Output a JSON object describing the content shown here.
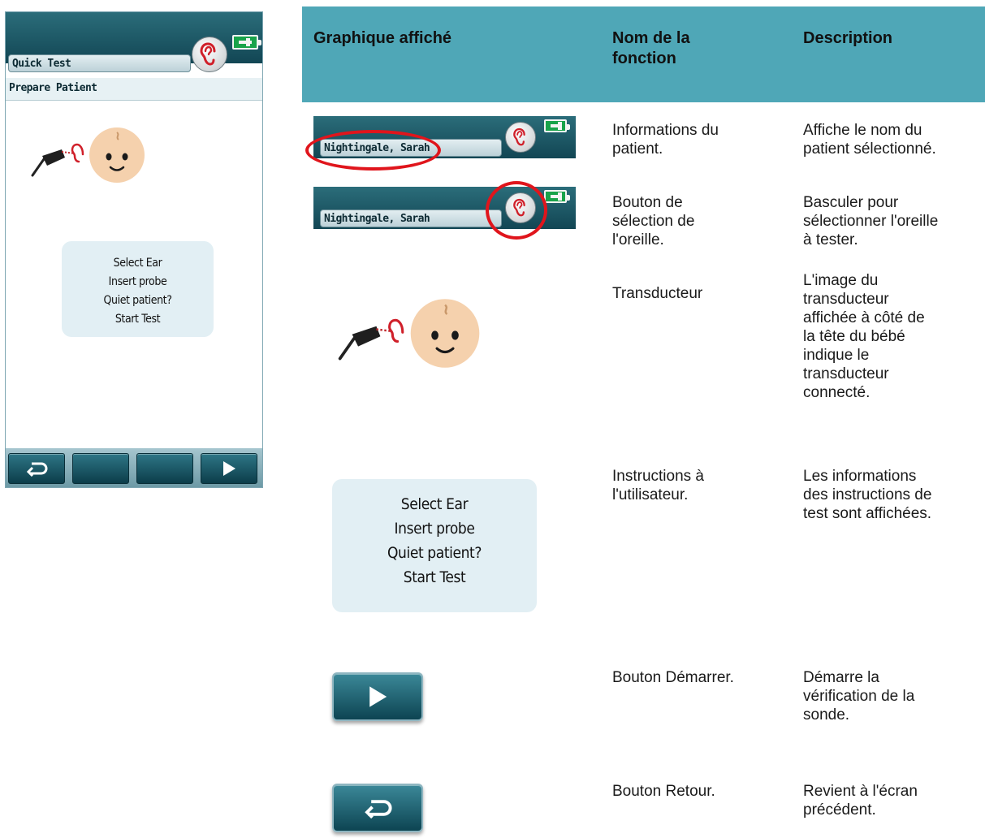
{
  "device": {
    "app_title": "Quick Test",
    "subtitle": "Prepare Patient",
    "instructions": [
      "Select Ear",
      "Insert probe",
      "Quiet patient?",
      "Start Test"
    ],
    "footer_buttons": [
      "back",
      "empty",
      "empty",
      "play"
    ]
  },
  "table": {
    "headers": {
      "graphic": "Graphique affiché",
      "function": "Nom de la\nfonction",
      "description": "Description"
    },
    "rows": [
      {
        "patient_name": "Nightingale, Sarah",
        "function": "Informations du\npatient.",
        "description": "Affiche le nom du\npatient sélectionné."
      },
      {
        "patient_name": "Nightingale, Sarah",
        "function": "Bouton de\nsélection de\nl'oreille.",
        "description": "Basculer pour\nsélectionner l'oreille\nà tester."
      },
      {
        "function": "Transducteur",
        "description": "L'image du\ntransducteur\naffichée à côté de\nla tête du bébé\nindique le\ntransducteur\nconnecté."
      },
      {
        "instructions": [
          "Select Ear",
          "Insert probe",
          "Quiet patient?",
          "Start Test"
        ],
        "function": "Instructions à\nl'utilisateur.",
        "description": "Les informations\ndes instructions de\ntest sont affichées."
      },
      {
        "function": "Bouton Démarrer.",
        "description": "Démarre la\nvérification de la\nsonde."
      },
      {
        "function": "Bouton Retour.",
        "description": "Revient à l'écran\nprécédent."
      }
    ]
  },
  "colors": {
    "header_teal": "#4fa7b7",
    "device_bar": "#124654",
    "highlight_red": "#e0151c",
    "battery_green": "#19a34a"
  }
}
